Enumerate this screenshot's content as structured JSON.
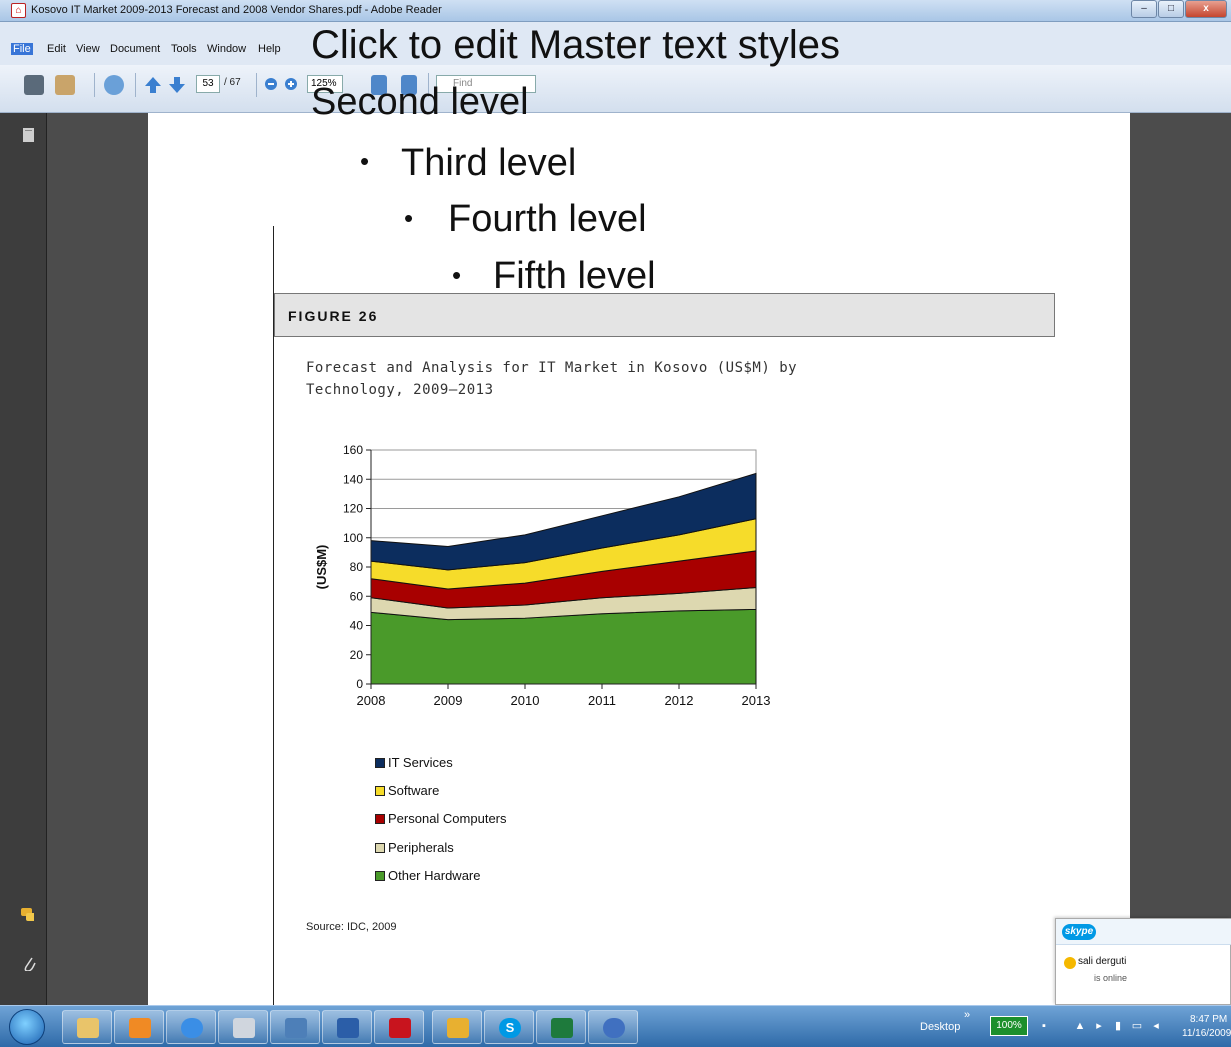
{
  "window": {
    "title": "Kosovo IT Market 2009-2013 Forecast and 2008 Vendor Shares.pdf - Adobe Reader",
    "controls": {
      "minimize": "–",
      "maximize": "□",
      "close": "x"
    }
  },
  "menu": {
    "items": [
      {
        "label": "File"
      },
      {
        "label": "Edit"
      },
      {
        "label": "View"
      },
      {
        "label": "Document"
      },
      {
        "label": "Tools"
      },
      {
        "label": "Window"
      },
      {
        "label": "Help"
      }
    ]
  },
  "toolbar": {
    "current_page": "53",
    "total_pages": "/ 67",
    "zoom": "125%",
    "find_placeholder": "Find"
  },
  "master_overlay": {
    "level1": "Click to edit Master text styles",
    "level2": "Second level",
    "level3": "Third level",
    "level4": "Fourth level",
    "level5": "Fifth level",
    "bullet": "•"
  },
  "figure": {
    "label": "FIGURE 26",
    "caption_line1": "Forecast and Analysis for IT Market in Kosovo (US$M) by",
    "caption_line2": "Technology, 2009–2013",
    "source": "Source: IDC, 2009"
  },
  "chart_data": {
    "type": "area",
    "stacked": true,
    "x": [
      "2008",
      "2009",
      "2010",
      "2011",
      "2012",
      "2013"
    ],
    "ylabel": "(US$M)",
    "ylim": [
      0,
      160
    ],
    "yticks": [
      "0",
      "20",
      "40",
      "60",
      "80",
      "100",
      "120",
      "140",
      "160"
    ],
    "grid": true,
    "series": [
      {
        "name": "Other Hardware",
        "color": "#4a9a2a",
        "values": [
          49,
          44,
          45,
          48,
          50,
          51
        ]
      },
      {
        "name": "Peripherals",
        "color": "#ddd8b0",
        "values": [
          10,
          8,
          9,
          11,
          12,
          15
        ]
      },
      {
        "name": "Personal Computers",
        "color": "#a80000",
        "values": [
          13,
          13,
          15,
          18,
          22,
          25
        ]
      },
      {
        "name": "Software",
        "color": "#f6dc2a",
        "values": [
          12,
          13,
          14,
          16,
          18,
          22
        ]
      },
      {
        "name": "IT Services",
        "color": "#0c2d5e",
        "values": [
          14,
          16,
          19,
          22,
          26,
          31
        ]
      }
    ],
    "legend": [
      {
        "name": "IT Services",
        "color": "#0c2d5e"
      },
      {
        "name": "Software",
        "color": "#f6dc2a"
      },
      {
        "name": "Personal Computers",
        "color": "#a80000"
      },
      {
        "name": "Peripherals",
        "color": "#ddd8b0"
      },
      {
        "name": "Other Hardware",
        "color": "#4a9a2a"
      }
    ]
  },
  "skype": {
    "logo": "skype",
    "contact": "sali derguti",
    "status": "is online"
  },
  "taskbar": {
    "desktop_label": "Desktop",
    "chevron": "»",
    "battery": "100%",
    "time": "8:47 PM",
    "date": "11/16/2009"
  }
}
